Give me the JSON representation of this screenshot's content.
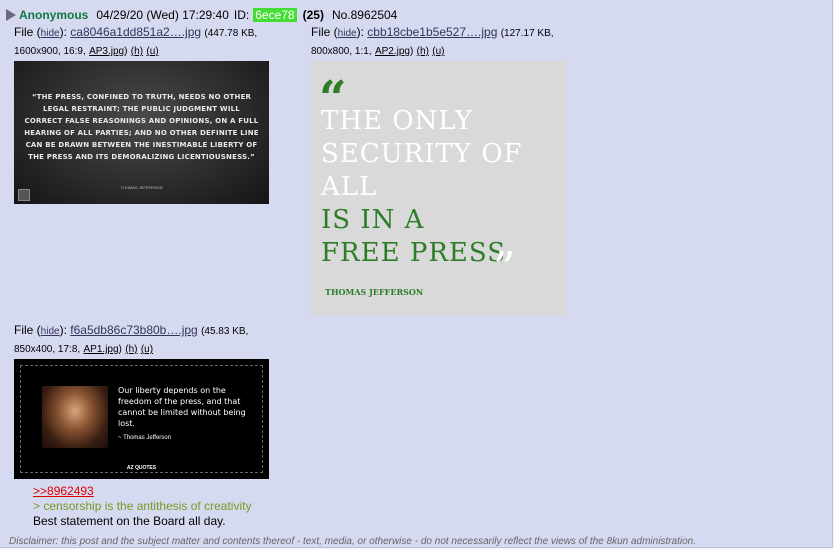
{
  "post": {
    "name": "Anonymous",
    "date": "04/29/20 (Wed) 17:29:40",
    "id_label": "ID:",
    "id": "6ece78",
    "replies": "(25)",
    "number": "No.8962504"
  },
  "files": [
    {
      "prefix": "File (",
      "hide": "hide",
      "sep": "):",
      "name": "ca8046a1dd851a2….jpg",
      "size": "(447.78 KB,",
      "dims": "1600x900, 16:9,",
      "orig": "AP3.jpg",
      "h": "(h)",
      "u": "(u)"
    },
    {
      "prefix": "File (",
      "hide": "hide",
      "sep": "):",
      "name": "cbb18cbe1b5e527….jpg",
      "size": "(127.17 KB,",
      "dims": "800x800, 1:1,",
      "orig": "AP2.jpg",
      "h": "(h)",
      "u": "(u)"
    },
    {
      "prefix": "File (",
      "hide": "hide",
      "sep": "):",
      "name": "f6a5db86c73b80b….jpg",
      "size": "(45.83 KB,",
      "dims": "850x400, 17:8,",
      "orig": "AP1.jpg",
      "h": "(h)",
      "u": "(u)"
    }
  ],
  "images": {
    "img1": {
      "quote": "“THE PRESS, CONFINED TO TRUTH, NEEDS NO OTHER LEGAL RESTRAINT; THE PUBLIC JUDGMENT WILL CORRECT FALSE REASONINGS AND OPINIONS, ON A FULL HEARING OF ALL PARTIES; AND NO OTHER DEFINITE LINE CAN BE DRAWN BETWEEN THE INESTIMABLE LIBERTY OF THE PRESS AND ITS DEMORALIZING LICENTIOUSNESS.”",
      "author": "THOMAS JEFFERSON"
    },
    "img2": {
      "line1": "THE ONLY",
      "line2": "SECURITY OF",
      "line3": "ALL",
      "line4": "IS IN A",
      "line5": "FREE PRESS",
      "open_quote": "“",
      "close_quote": "”",
      "author": "THOMAS JEFFERSON"
    },
    "img3": {
      "quote": "Our liberty depends on the freedom of the press, and that cannot be limited without being lost.",
      "author": "~ Thomas Jefferson",
      "brand": "AZ QUOTES"
    }
  },
  "body": {
    "reference": ">>8962493",
    "greentext": "> censorship is the antithesis of creativity",
    "text": "Best statement on the Board all day."
  },
  "disclaimer": "Disclaimer: this post and the subject matter and contents thereof - text, media, or otherwise - do not necessarily reflect the views of the 8kun administration.",
  "colors": {
    "name": "#117743",
    "id_bg": "#44dd33",
    "greentext": "#789922",
    "reference": "#dd0000",
    "post_bg": "#d6daf0"
  }
}
